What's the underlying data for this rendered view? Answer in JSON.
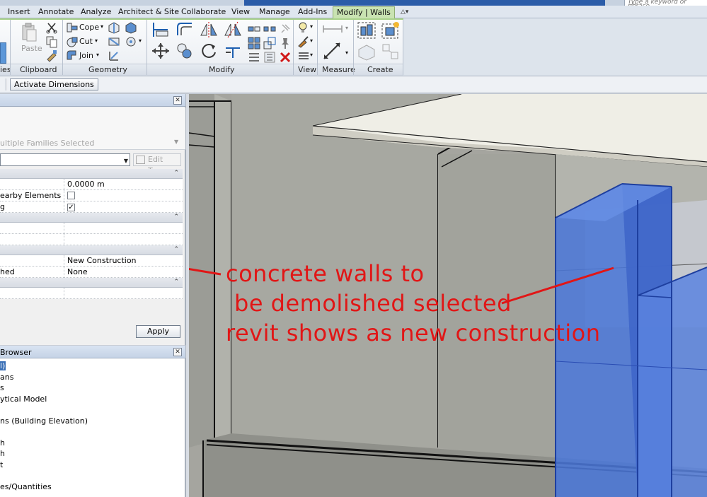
{
  "title_bar": {
    "search_placeholder": "Type a keyword or phrase"
  },
  "ribbon_tabs": [
    {
      "label": "Insert"
    },
    {
      "label": "Annotate"
    },
    {
      "label": "Analyze"
    },
    {
      "label": "Architect & Site"
    },
    {
      "label": "Collaborate"
    },
    {
      "label": "View"
    },
    {
      "label": "Manage"
    },
    {
      "label": "Add-Ins"
    },
    {
      "label": "Modify | Walls"
    }
  ],
  "ribbon": {
    "properties_label": "ies",
    "clipboard": {
      "paste_label": "Paste",
      "panel_label": "Clipboard"
    },
    "geometry": {
      "cope_label": "Cope",
      "cut_label": "Cut",
      "join_label": "Join",
      "panel_label": "Geometry"
    },
    "modify": {
      "panel_label": "Modify"
    },
    "view": {
      "panel_label": "View"
    },
    "measure": {
      "panel_label": "Measure"
    },
    "create": {
      "panel_label": "Create"
    }
  },
  "options_bar": {
    "activate_dimensions_label": "Activate Dimensions"
  },
  "properties": {
    "type_selector_text": "ultiple Families Selected",
    "edit_type_label": "Edit Type",
    "rows": [
      {
        "kind": "header"
      },
      {
        "name": "",
        "value": "0.0000 m"
      },
      {
        "name": "earby Elements",
        "checkbox": false
      },
      {
        "name": "g",
        "checkbox": true
      },
      {
        "kind": "header"
      },
      {
        "name": "",
        "value": ""
      },
      {
        "name": "",
        "value": ""
      },
      {
        "kind": "header"
      },
      {
        "name": "",
        "value": "New Construction"
      },
      {
        "name": "hed",
        "value": "None"
      },
      {
        "kind": "header"
      },
      {
        "name": "",
        "value": ""
      }
    ],
    "apply_label": "Apply"
  },
  "project_browser": {
    "title": "Browser",
    "items": [
      {
        "label": "l)",
        "selected": true
      },
      {
        "label": "ans"
      },
      {
        "label": "s"
      },
      {
        "label": "ytical Model"
      },
      {
        "label": ""
      },
      {
        "label": "ns (Building Elevation)"
      },
      {
        "label": ""
      },
      {
        "label": "h"
      },
      {
        "label": "h"
      },
      {
        "label": "t"
      },
      {
        "label": ""
      },
      {
        "label": "es/Quantities"
      },
      {
        "label": ""
      }
    ]
  },
  "annotation": {
    "line1": "concrete walls to",
    "line2": "be demolished selected",
    "line3": "revit shows as new construction",
    "color": "#e11616"
  },
  "colors": {
    "selection_blue": "#3f6fd2",
    "ribbon_active_tab": "#c9e3b2"
  }
}
